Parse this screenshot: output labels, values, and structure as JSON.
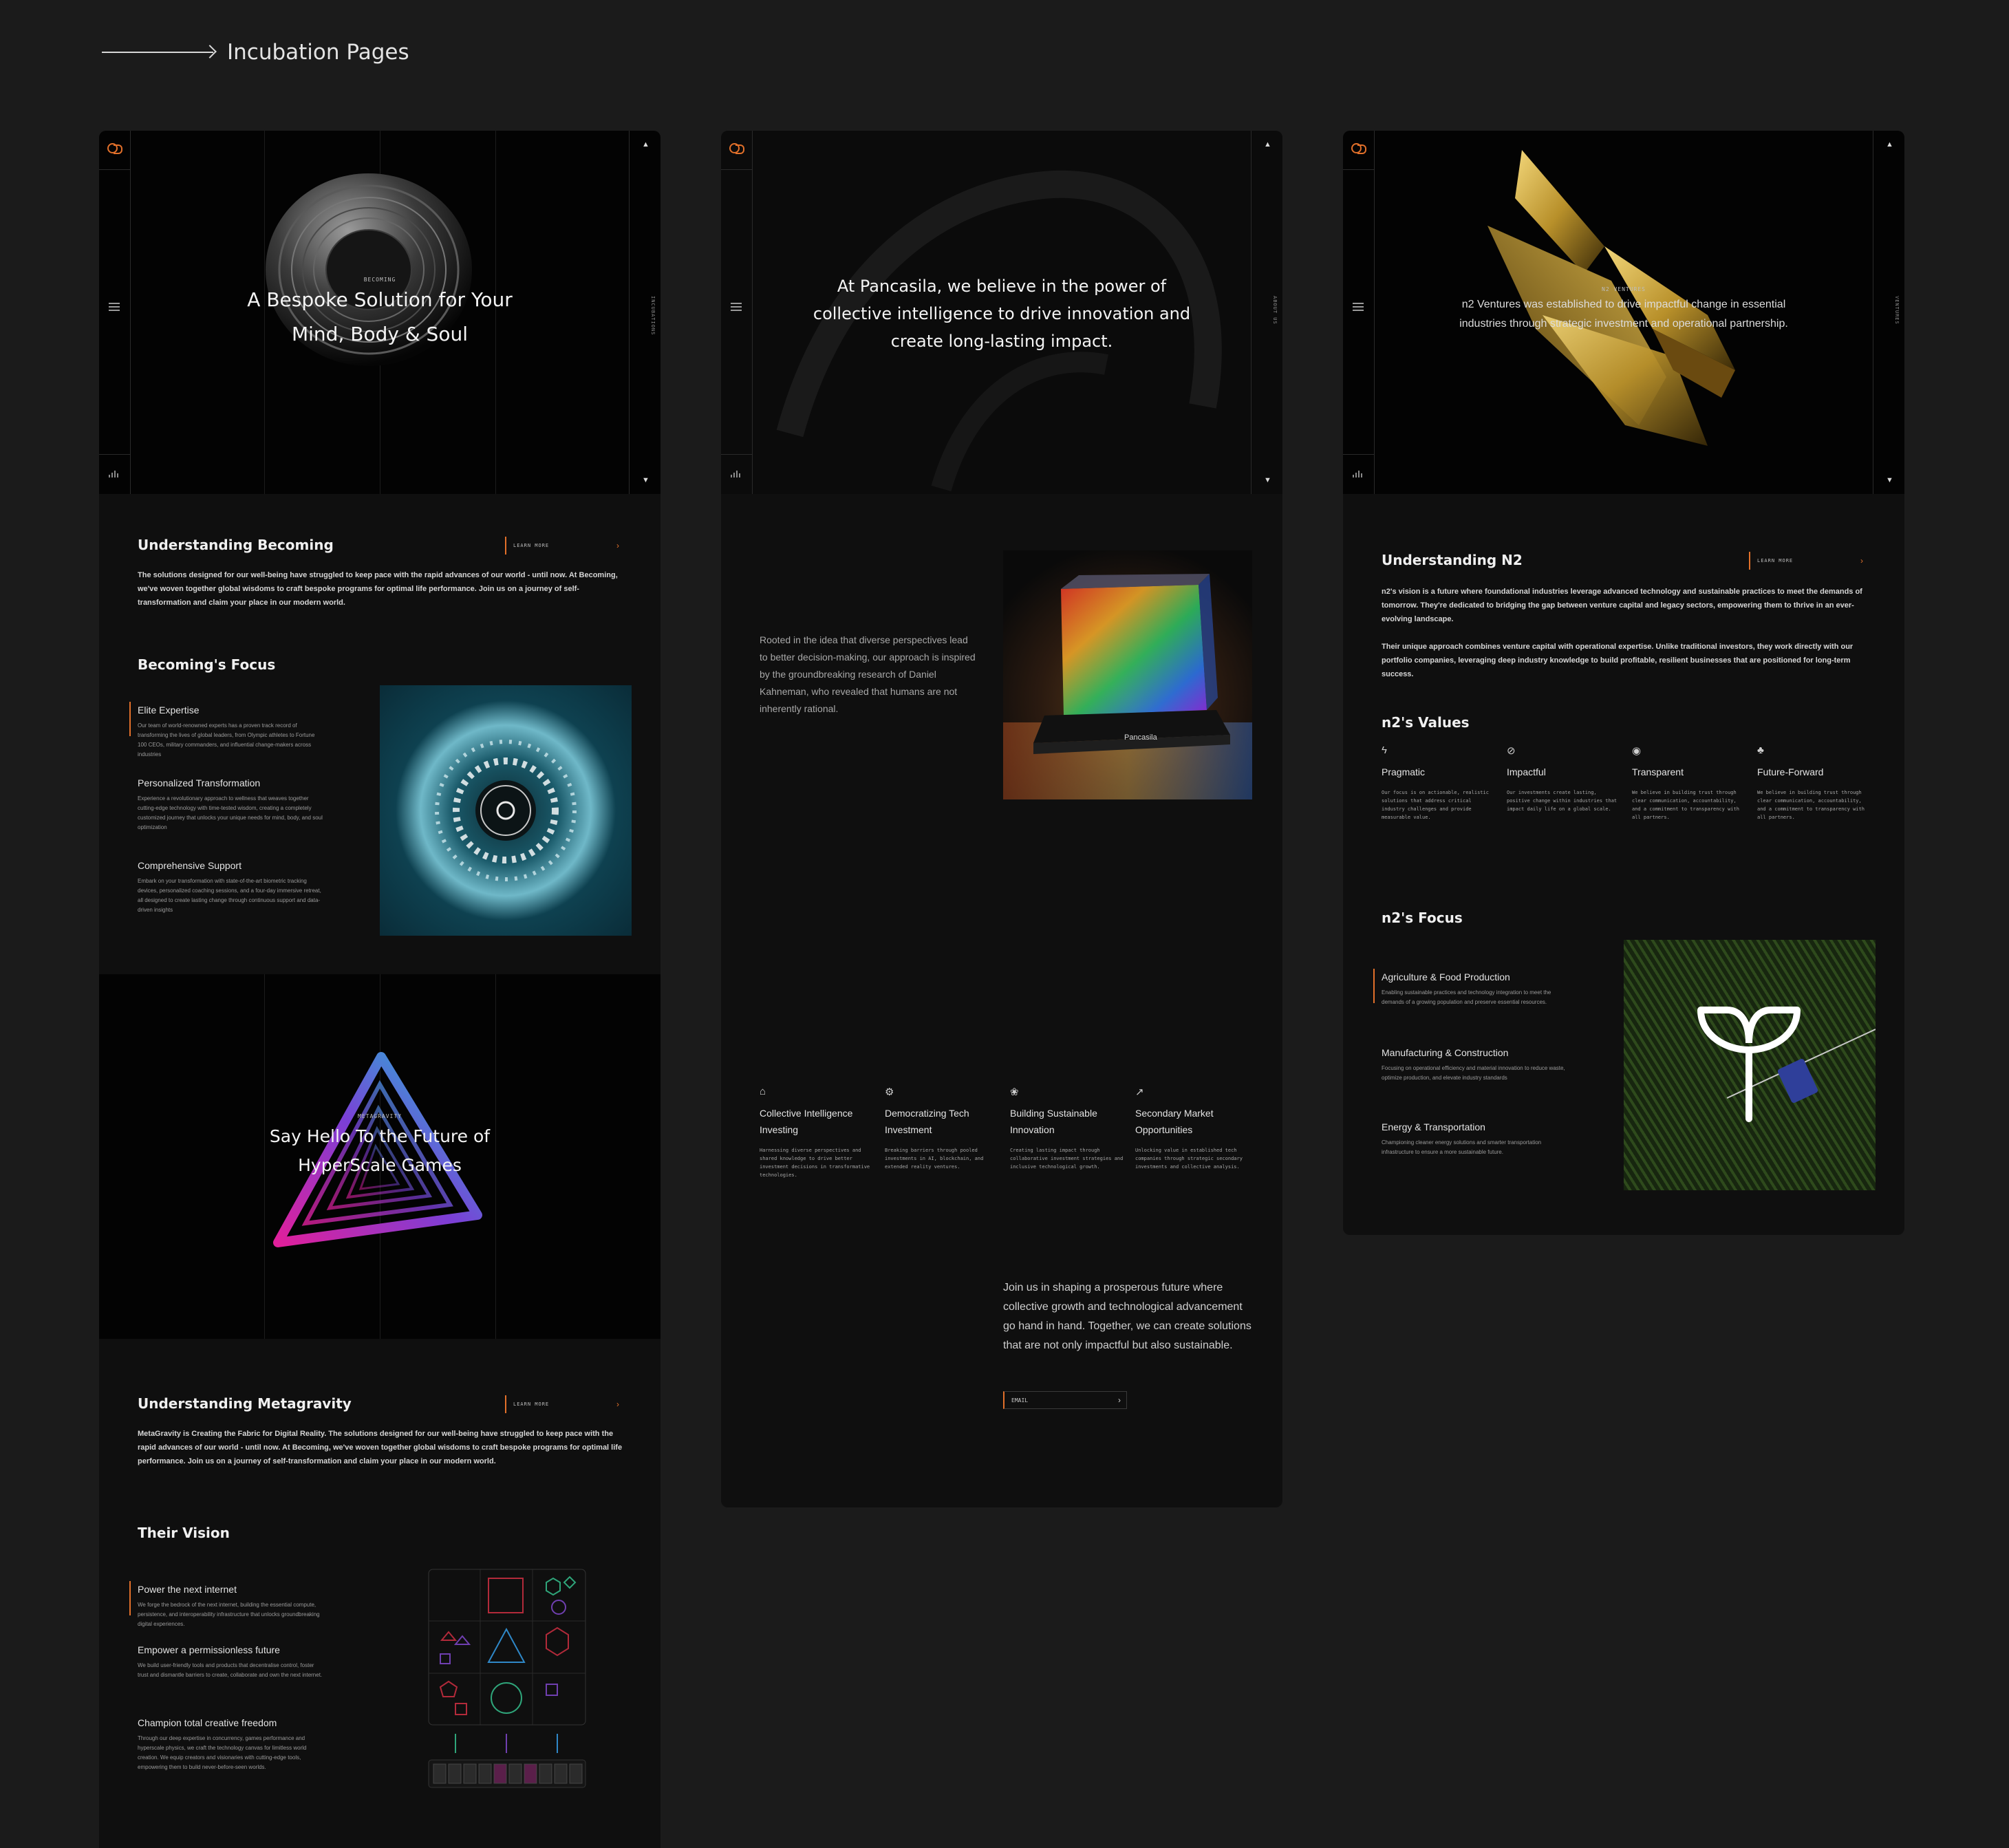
{
  "header": {
    "title": "Incubation Pages"
  },
  "becoming": {
    "hero": {
      "eyebrow": "BECOMING",
      "title_line1": "A Bespoke Solution for Your",
      "title_line2": "Mind, Body & Soul",
      "rail_label": "INCUBATIONS"
    },
    "understanding": {
      "title": "Understanding Becoming",
      "learn_more": "LEARN MORE",
      "body": "The solutions designed for our well-being have struggled to keep pace with the rapid advances of our world - until now. At Becoming, we've woven together global wisdoms to craft bespoke programs for optimal life performance. Join us on a journey of self-transformation and claim your place in our modern world."
    },
    "focus": {
      "title": "Becoming's Focus",
      "items": [
        {
          "title": "Elite Expertise",
          "text": "Our team of world-renowned experts has a proven track record of transforming the lives of global leaders, from Olympic athletes to Fortune 100 CEOs, military commanders, and influential change-makers across industries"
        },
        {
          "title": "Personalized Transformation",
          "text": "Experience a revolutionary approach to wellness that weaves together cutting-edge technology with time-tested wisdom, creating a completely customized journey that unlocks your unique needs for mind, body, and soul optimization"
        },
        {
          "title": "Comprehensive Support",
          "text": "Embark on your transformation with state-of-the-art biometric tracking devices, personalized coaching sessions, and a four-day immersive retreat, all designed to create lasting change through continuous support and data-driven insights"
        }
      ]
    }
  },
  "metagravity": {
    "hero": {
      "eyebrow": "METAGRAVITY",
      "title_line1": "Say Hello To the Future of",
      "title_line2": "HyperScale Games"
    },
    "understanding": {
      "title": "Understanding Metagravity",
      "learn_more": "LEARN MORE",
      "body": "MetaGravity is Creating the Fabric for Digital Reality. The solutions designed for our well-being have struggled to keep pace with the rapid advances of our world - until now. At Becoming, we've woven together global wisdoms to craft bespoke programs for optimal life performance. Join us on a journey of self-transformation and claim your place in our modern world."
    },
    "vision": {
      "title": "Their Vision",
      "items": [
        {
          "title": "Power the next internet",
          "text": "We forge the bedrock of the next internet, building the essential compute, persistence, and interoperability infrastructure that unlocks groundbreaking digital experiences."
        },
        {
          "title": "Empower a permissionless future",
          "text": "We build user-friendly tools and products that decentralise control, foster trust and dismantle barriers to create, collaborate and own the next internet."
        },
        {
          "title": "Champion total creative freedom",
          "text": "Through our deep expertise in concurrency, games performance and hyperscale physics, we craft the technology canvas for limitless world creation. We equip creators and visionaries with cutting-edge tools, empowering them to build never-before-seen worlds."
        }
      ]
    }
  },
  "pancasila": {
    "hero": {
      "line1": "At Pancasila, we believe in the power of",
      "line2": "collective intelligence to drive innovation and",
      "line3": "create long-lasting impact.",
      "rail_label": "ABOUT US"
    },
    "intro": "Rooted in the idea that diverse perspectives lead to better decision-making, our approach is inspired by the groundbreaking research of Daniel Kahneman, who revealed that humans are not inherently rational.",
    "product_label": "Pancasila",
    "pillars": [
      {
        "icon": "robot-icon",
        "glyph": "⌂",
        "title": "Collective Intelligence Investing",
        "text": "Harnessing diverse perspectives and shared knowledge to drive better investment decisions in transformative technologies."
      },
      {
        "icon": "gear-icon",
        "glyph": "⚙",
        "title": "Democratizing Tech Investment",
        "text": "Breaking barriers through pooled investments in AI, blockchain, and extended reality ventures."
      },
      {
        "icon": "leaf-icon",
        "glyph": "❀",
        "title": "Building Sustainable Innovation",
        "text": "Creating lasting impact through collaborative investment strategies and inclusive technological growth."
      },
      {
        "icon": "chart-icon",
        "glyph": "↗",
        "title": "Secondary Market Opportunities",
        "text": "Unlocking value in established tech companies through strategic secondary investments and collective analysis."
      }
    ],
    "closing": "Join us in shaping a prosperous future where collective growth and technological advancement go hand in hand. Together, we can create solutions that are not only impactful but also sustainable.",
    "email_label": "EMAIL"
  },
  "n2": {
    "hero": {
      "eyebrow": "N2 VENTURES",
      "line1": "n2 Ventures was established to drive impactful change in essential",
      "line2": "industries through strategic investment and operational partnership.",
      "rail_label": "VENTURES"
    },
    "understanding": {
      "title": "Understanding N2",
      "learn_more": "LEARN MORE",
      "body1": "n2's vision is a future where foundational industries leverage advanced technology and sustainable practices to meet the demands of tomorrow. They're dedicated to bridging the gap between venture capital and legacy sectors, empowering them to thrive in an ever-evolving landscape.",
      "body2": "Their unique approach combines venture capital with operational expertise. Unlike traditional investors, they work directly with our portfolio companies, leveraging deep industry knowledge to build profitable, resilient businesses that are positioned for long-term success."
    },
    "values": {
      "title": "n2's Values",
      "items": [
        {
          "icon": "lightning-icon",
          "glyph": "ϟ",
          "title": "Pragmatic",
          "text": "Our focus is on actionable, realistic solutions that address critical industry challenges and provide measurable value."
        },
        {
          "icon": "target-icon",
          "glyph": "⊘",
          "title": "Impactful",
          "text": "Our investments create lasting, positive change within industries that impact daily life on a global scale."
        },
        {
          "icon": "signal-icon",
          "glyph": "◉",
          "title": "Transparent",
          "text": "We believe in building trust through clear communication, accountability, and a commitment to transparency with all partners."
        },
        {
          "icon": "sprout-icon",
          "glyph": "♣",
          "title": "Future-Forward",
          "text": "We believe in building trust through clear communication, accountability, and a commitment to transparency with all partners."
        }
      ]
    },
    "focus": {
      "title": "n2's Focus",
      "items": [
        {
          "title": "Agriculture & Food Production",
          "text": "Enabling sustainable practices and technology integration to meet the demands of a growing population and preserve essential resources."
        },
        {
          "title": "Manufacturing & Construction",
          "text": "Focusing on operational efficiency and material innovation to reduce waste, optimize production, and elevate industry standards"
        },
        {
          "title": "Energy & Transportation",
          "text": "Championing cleaner energy solutions and smarter transportation infrastructure to ensure a more sustainable future."
        }
      ]
    }
  }
}
